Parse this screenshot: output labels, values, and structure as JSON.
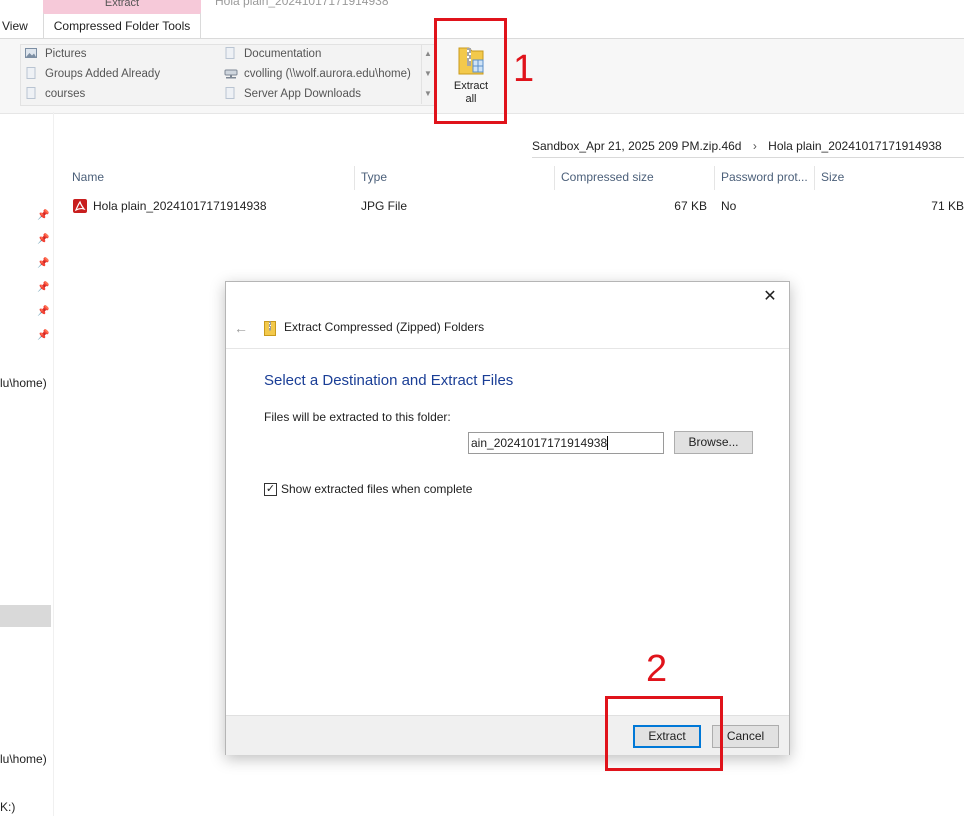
{
  "ribbon": {
    "context_tab": "Extract",
    "view_tab": "View",
    "compressed_tab": "Compressed Folder Tools",
    "faded_window_title": "Hola plain_20241017171914938",
    "destinations": [
      {
        "label": "Pictures",
        "icon": "pictures-folder-icon"
      },
      {
        "label": "Groups Added Already",
        "icon": "folder-icon"
      },
      {
        "label": "courses",
        "icon": "folder-icon"
      },
      {
        "label": "Documentation",
        "icon": "folder-icon"
      },
      {
        "label": "cvolling (\\\\wolf.aurora.edu\\home)",
        "icon": "network-drive-icon"
      },
      {
        "label": "Server App Downloads",
        "icon": "folder-icon"
      }
    ],
    "extract_all_label_1": "Extract",
    "extract_all_label_2": "all"
  },
  "annotations": {
    "step1": "1",
    "step2": "2",
    "color": "#e0131b"
  },
  "address": {
    "segment1": "Sandbox_Apr 21, 2025 209 PM.zip.46d",
    "segment2": "Hola plain_20241017171914938"
  },
  "file_list": {
    "columns": [
      "Name",
      "Type",
      "Compressed size",
      "Password prot...",
      "Size"
    ],
    "rows": [
      {
        "name": "Hola plain_20241017171914938",
        "type": "JPG File",
        "compressed_size": "67 KB",
        "password": "No",
        "size": "71 KB"
      }
    ]
  },
  "nav": {
    "item_home1": "lu\\home)",
    "item_home2": "lu\\home)",
    "item_drive": "K:)"
  },
  "dialog": {
    "title": "Extract Compressed (Zipped) Folders",
    "heading": "Select a Destination and Extract Files",
    "folder_label": "Files will be extracted to this folder:",
    "path_value": "ain_20241017171914938",
    "browse_label": "Browse...",
    "show_files_label": "Show extracted files when complete",
    "show_files_checked": true,
    "extract_label": "Extract",
    "cancel_label": "Cancel"
  }
}
